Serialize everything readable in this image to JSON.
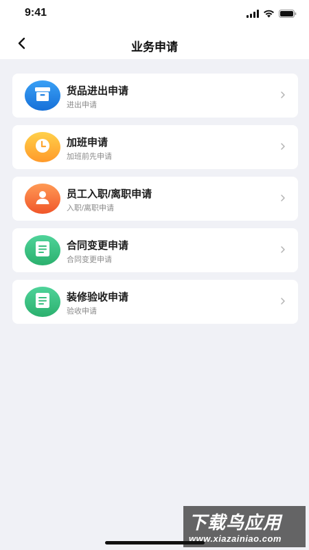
{
  "status_bar": {
    "time": "9:41"
  },
  "nav": {
    "title": "业务申请"
  },
  "items": [
    {
      "title": "货品进出申请",
      "subtitle": "进出申请",
      "icon": "archive-box-icon",
      "color_from": "#3aa0f5",
      "color_to": "#1670d8"
    },
    {
      "title": "加班申请",
      "subtitle": "加班前先申请",
      "icon": "clock-icon",
      "color_from": "#ffd04a",
      "color_to": "#ff9a2a"
    },
    {
      "title": "员工入职/离职申请",
      "subtitle": "入职/离职申请",
      "icon": "user-icon",
      "color_from": "#ff9a55",
      "color_to": "#f0562a"
    },
    {
      "title": "合同变更申请",
      "subtitle": "合同变更申请",
      "icon": "document-icon",
      "color_from": "#4fd39a",
      "color_to": "#2bb06e"
    },
    {
      "title": "装修验收申请",
      "subtitle": "验收申请",
      "icon": "document-icon",
      "color_from": "#4fd39a",
      "color_to": "#2bb06e"
    }
  ],
  "watermark": {
    "title": "下载鸟应用",
    "url": "www.xiazainiao.com"
  }
}
